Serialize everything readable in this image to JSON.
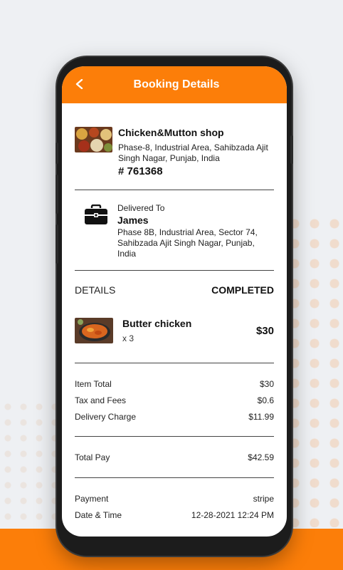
{
  "colors": {
    "accent": "#fc7e09",
    "text": "#111111"
  },
  "header": {
    "title": "Booking Details",
    "back_icon": "chevron-left-icon"
  },
  "shop": {
    "name": "Chicken&Mutton shop",
    "address": "Phase-8, Industrial Area, Sahibzada Ajit Singh Nagar, Punjab, India",
    "order_no": "# 761368"
  },
  "delivery": {
    "label": "Delivered To",
    "name": "James",
    "address": "Phase 8B, Industrial Area, Sector 74, Sahibzada Ajit Singh Nagar, Punjab, India",
    "icon": "briefcase-icon"
  },
  "details": {
    "label": "DETAILS",
    "status": "COMPLETED"
  },
  "item": {
    "name": "Butter chicken",
    "qty": "x 3",
    "price": "$30"
  },
  "summary": {
    "item_total_label": "Item Total",
    "item_total": "$30",
    "tax_label": "Tax and Fees",
    "tax": "$0.6",
    "delivery_label": "Delivery Charge",
    "delivery": "$11.99",
    "total_label": "Total Pay",
    "total": "$42.59",
    "payment_label": "Payment",
    "payment": "stripe",
    "datetime_label": "Date & Time",
    "datetime": "12-28-2021 12:24 PM"
  }
}
